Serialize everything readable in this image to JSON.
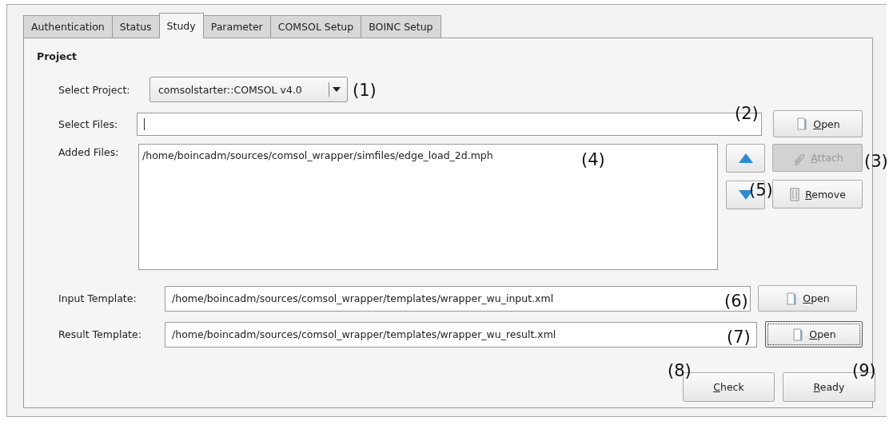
{
  "tabs": [
    {
      "label": "Authentication",
      "selected": false
    },
    {
      "label": "Status",
      "selected": false
    },
    {
      "label": "Study",
      "selected": true
    },
    {
      "label": "Parameter",
      "selected": false
    },
    {
      "label": "COMSOL Setup",
      "selected": false
    },
    {
      "label": "BOINC Setup",
      "selected": false
    }
  ],
  "section_title": "Project",
  "select_project": {
    "label": "Select Project:",
    "value": "comsolstarter::COMSOL v4.0"
  },
  "select_files": {
    "label": "Select Files:",
    "button": {
      "label": "Open",
      "focused": false
    }
  },
  "added_files": {
    "label": "Added Files:",
    "items": [
      "/home/boincadm/sources/comsol_wrapper/simfiles/edge_load_2d.mph"
    ],
    "buttons": [
      {
        "label": "Attach",
        "disabled": true
      },
      {
        "label": "Remove",
        "disabled": false
      }
    ]
  },
  "input_template": {
    "label": "Input Template:",
    "value": "/home/boincadm/sources/comsol_wrapper/templates/wrapper_wu_input.xml",
    "button": {
      "label": "Open",
      "focused": false
    }
  },
  "result_template": {
    "label": "Result Template:",
    "value": "/home/boincadm/sources/comsol_wrapper/templates/wrapper_wu_result.xml",
    "button": {
      "label": "Open",
      "focused": true
    }
  },
  "actions": [
    {
      "label": "Check"
    },
    {
      "label": "Ready"
    }
  ],
  "callouts": [
    "(1)",
    "(2)",
    "(3)",
    "(4)",
    "(5)",
    "(6)",
    "(7)",
    "(8)",
    "(9)"
  ]
}
